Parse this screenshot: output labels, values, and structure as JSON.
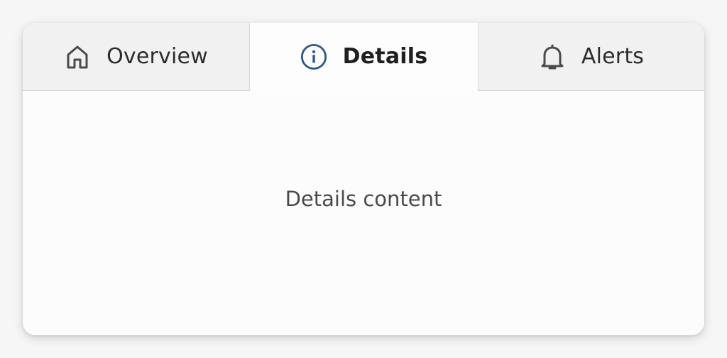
{
  "tabs": [
    {
      "label": "Overview",
      "icon": "home-icon",
      "selected": false
    },
    {
      "label": "Details",
      "icon": "info-icon",
      "selected": true
    },
    {
      "label": "Alerts",
      "icon": "bell-icon",
      "selected": false
    }
  ],
  "panel": {
    "text": "Details content"
  },
  "colors": {
    "accent": "#2d5a8a",
    "icon_default": "#4a4a4a"
  }
}
